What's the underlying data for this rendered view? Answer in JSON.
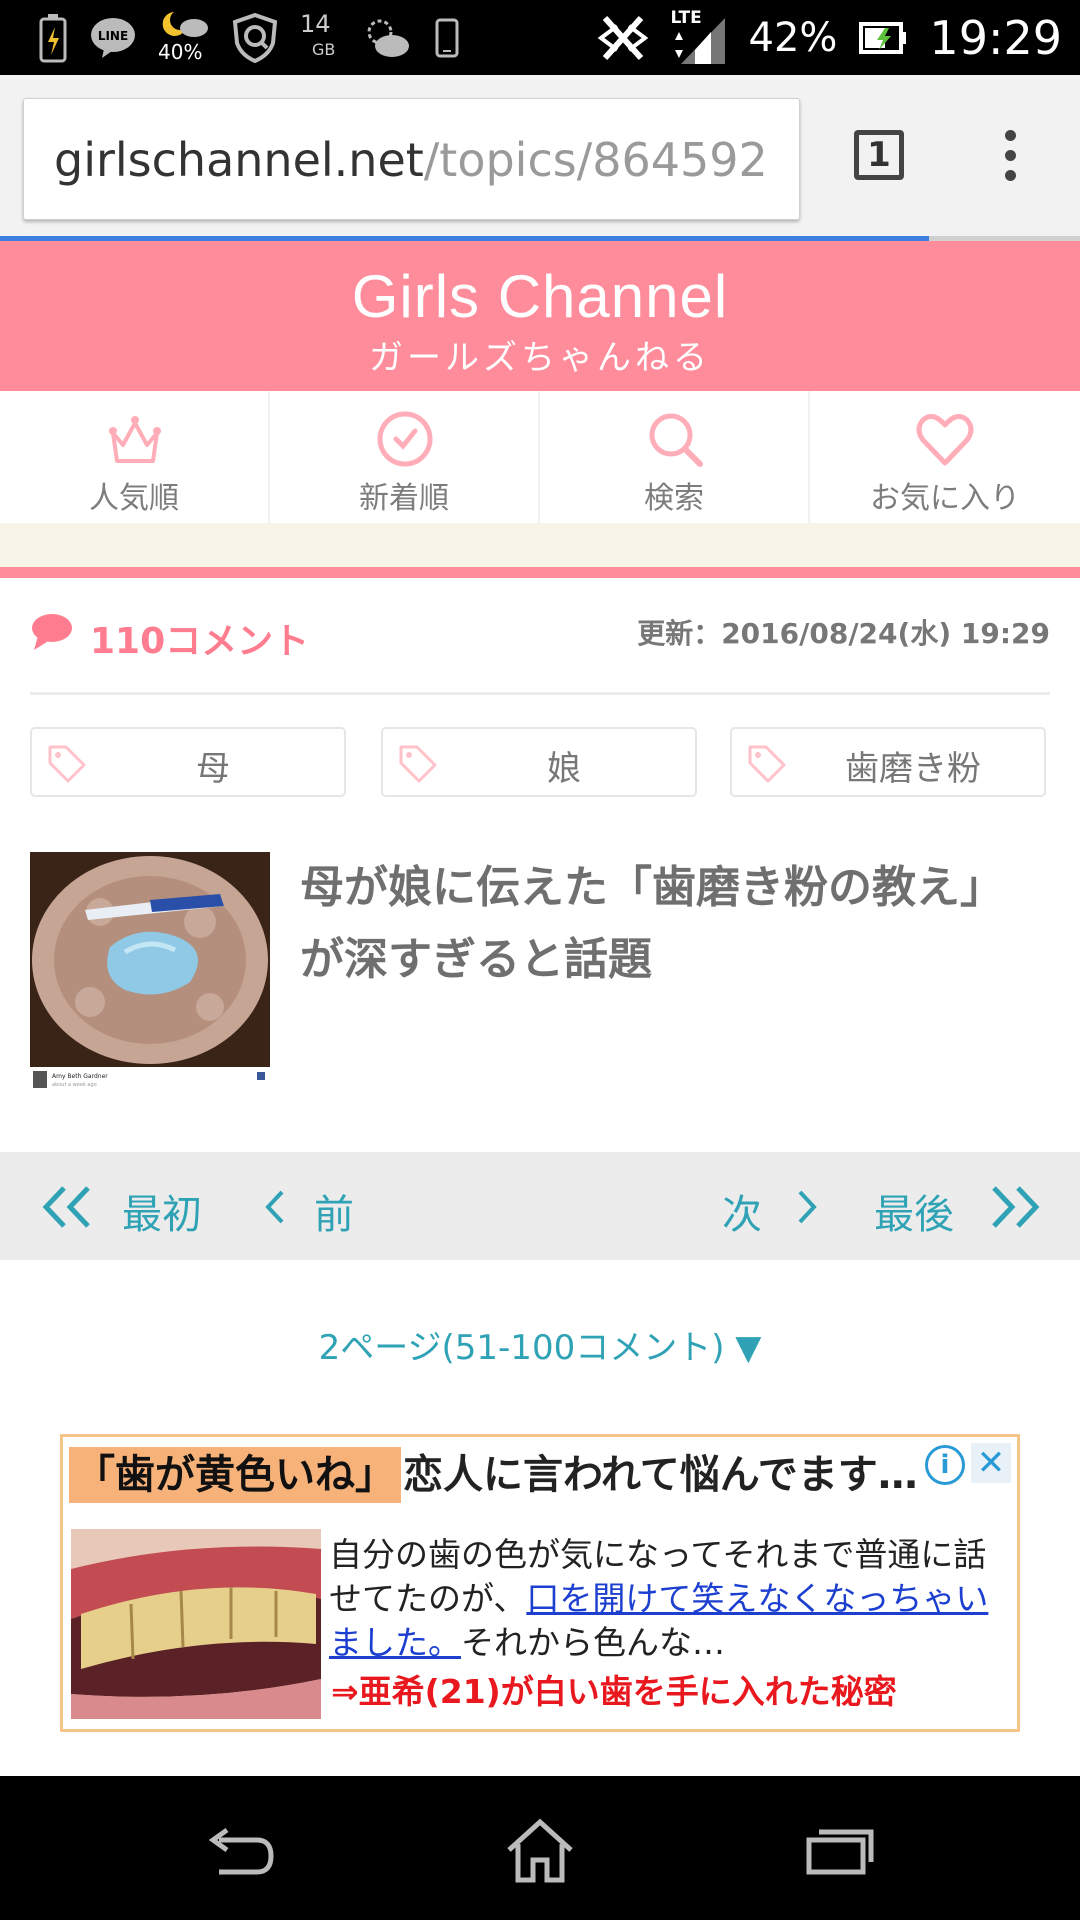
{
  "status_bar": {
    "left_icons": [
      "battery-saver-icon",
      "line-app-icon",
      "weather-icon",
      "shield-app-icon",
      "storage-icon",
      "cloud-weather-icon",
      "phone-icon"
    ],
    "weather_percent": "40%",
    "storage_value": "14",
    "storage_unit": "GB",
    "lte_label": "LTE",
    "battery_percent": "42%",
    "time": "19:29"
  },
  "browser": {
    "url_host": "girlschannel.net",
    "url_path": "/topics/864592",
    "tab_count": "1",
    "load_progress": 0.86
  },
  "site": {
    "logo": "Girls Channel",
    "logo_sub": "ガールズちゃんねる",
    "brand_color": "#ff8c9b",
    "accent_color": "#2fa3b5"
  },
  "nav": [
    {
      "label": "人気順",
      "icon": "crown-icon"
    },
    {
      "label": "新着順",
      "icon": "clock-icon"
    },
    {
      "label": "検索",
      "icon": "search-icon"
    },
    {
      "label": "お気に入り",
      "icon": "heart-icon"
    }
  ],
  "topic": {
    "comment_count": "110コメント",
    "updated": "更新：2016/08/24(水) 19:29",
    "tags": [
      "母",
      "娘",
      "歯磨き粉"
    ],
    "headline": "母が娘に伝えた「歯磨き粉の教え」が深すぎると話題",
    "thumb_caption_name": "Amy Beth Gardner",
    "thumb_caption_sub": "about a week ago"
  },
  "pager": {
    "first": "最初",
    "prev": "前",
    "next": "次",
    "last": "最後",
    "page_info": "2ページ(51-100コメント) ▼"
  },
  "ad": {
    "title_highlight": "「歯が黄色いね」",
    "title_rest": "恋人に言われて悩んでます…",
    "body_start": "自分の歯の色が気になってそれまで普通に話せてたのが、",
    "body_link": "口を開けて笑えなくなっちゃいました。",
    "body_end": "それから色んな…",
    "cta": "⇒亜希(21)が白い歯を手に入れた秘密",
    "info_label": "i",
    "close_label": "✕"
  }
}
